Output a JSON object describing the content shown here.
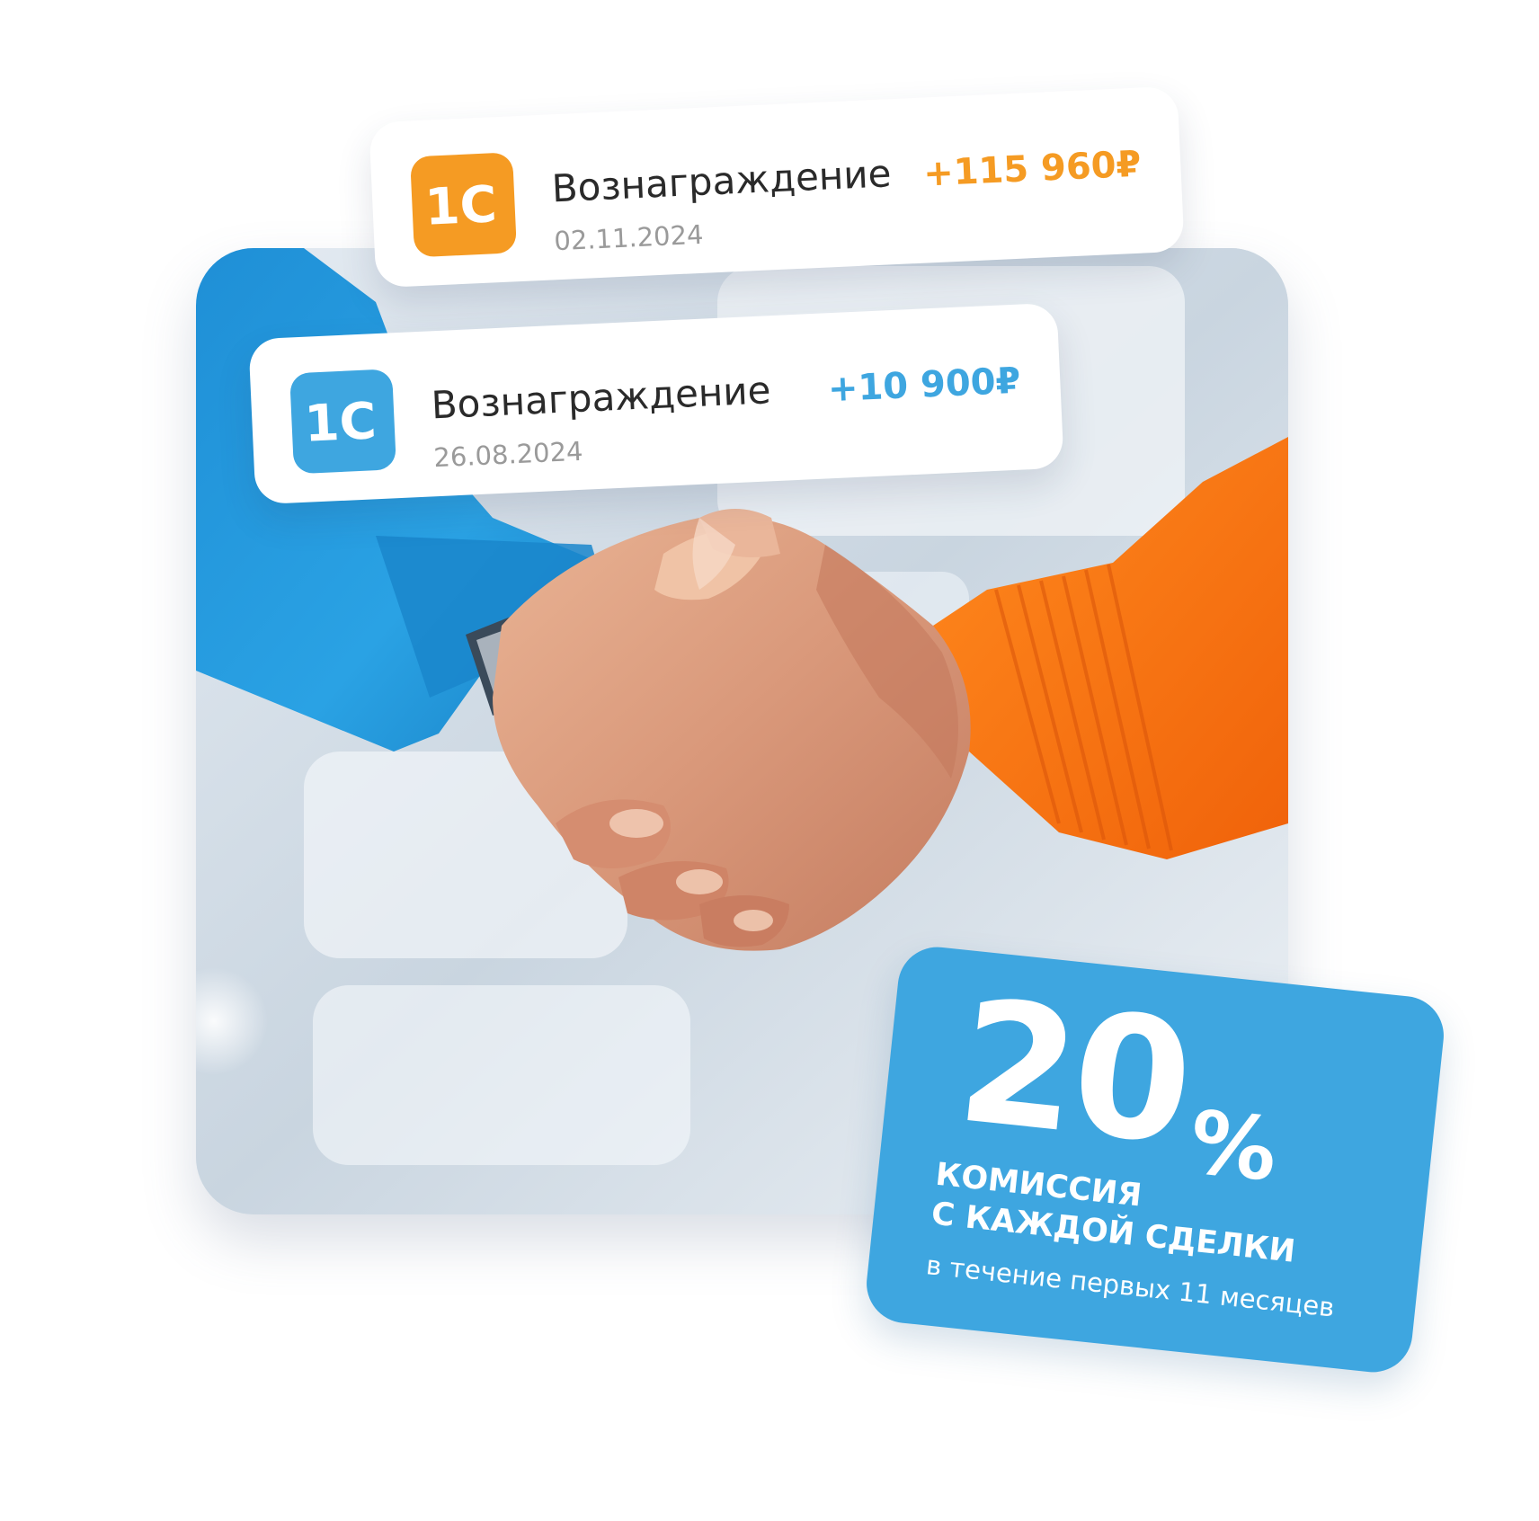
{
  "transactions": [
    {
      "logo": "1С",
      "title": "Вознаграждение",
      "date": "02.11.2024",
      "amount": "+115 960₽",
      "accent": "#f59b23"
    },
    {
      "logo": "1С",
      "title": "Вознаграждение",
      "date": "26.08.2024",
      "amount": "+10 900₽",
      "accent": "#3ea6e0"
    }
  ],
  "promo": {
    "number": "20",
    "percent": "%",
    "line1": "комиссия",
    "line2": "с каждой сделки",
    "subtitle": "в течение первых 11 месяцев",
    "background": "#3ea6e0"
  },
  "photo": {
    "subject": "handshake-photo"
  }
}
